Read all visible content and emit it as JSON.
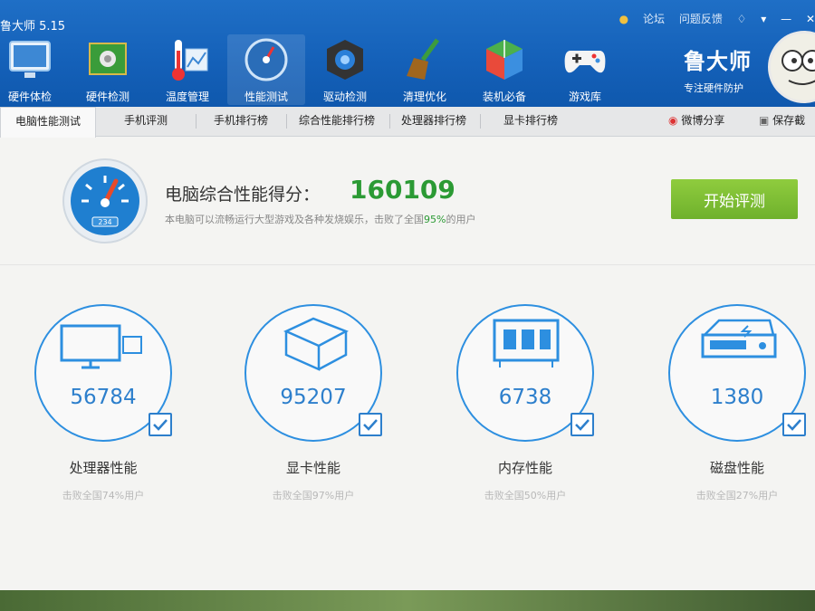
{
  "app": {
    "title": "鲁大师 5.15"
  },
  "toolbar": [
    {
      "label": "硬件体检",
      "icon": "monitor-icon"
    },
    {
      "label": "硬件检测",
      "icon": "board-icon"
    },
    {
      "label": "温度管理",
      "icon": "thermometer-icon"
    },
    {
      "label": "性能测试",
      "icon": "gauge-icon",
      "active": true
    },
    {
      "label": "驱动检测",
      "icon": "driver-icon"
    },
    {
      "label": "清理优化",
      "icon": "broom-icon"
    },
    {
      "label": "装机必备",
      "icon": "box-icon"
    },
    {
      "label": "游戏库",
      "icon": "gamepad-icon"
    }
  ],
  "toplinks": {
    "forum": "论坛",
    "feedback": "问题反馈"
  },
  "brand": {
    "name": "鲁大师",
    "slogan": "专注硬件防护"
  },
  "tabs": [
    "电脑性能测试",
    "手机评测",
    "手机排行榜",
    "综合性能排行榜",
    "处理器排行榜",
    "显卡排行榜"
  ],
  "tab_right": {
    "share": "微博分享",
    "save": "保存截"
  },
  "score": {
    "title": "电脑综合性能得分：",
    "value": "160109",
    "desc_pre": "本电脑可以流畅运行大型游戏及各种发烧娱乐，击败了全国",
    "desc_pct": "95%",
    "desc_post": "的用户",
    "gauge_readout": "234"
  },
  "start_button": "开始评测",
  "components": [
    {
      "name": "处理器性能",
      "value": "56784",
      "sub": "击败全国74%用户",
      "icon": "cpu-monitor-icon"
    },
    {
      "name": "显卡性能",
      "value": "95207",
      "sub": "击败全国97%用户",
      "icon": "graphics-icon"
    },
    {
      "name": "内存性能",
      "value": "6738",
      "sub": "击败全国50%用户",
      "icon": "memory-icon"
    },
    {
      "name": "磁盘性能",
      "value": "1380",
      "sub": "击败全国27%用户",
      "icon": "disk-icon"
    }
  ],
  "colors": {
    "header": "#1460b8",
    "accent": "#2d8fe0",
    "score": "#2b9a34",
    "button": "#7bbd33"
  }
}
